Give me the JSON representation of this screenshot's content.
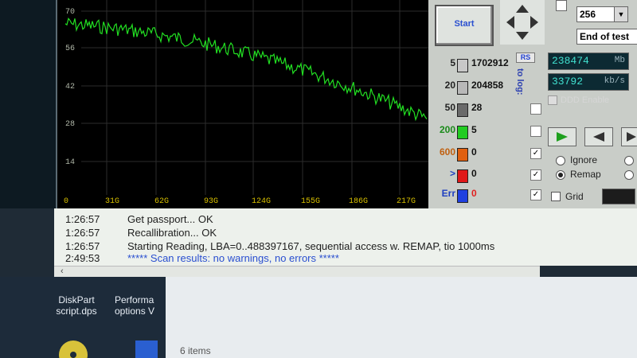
{
  "graph": {
    "y_ticks": [
      "70",
      "56",
      "42",
      "28",
      "14"
    ],
    "x_ticks": [
      "0",
      "31G",
      "62G",
      "93G",
      "124G",
      "155G",
      "186G",
      "217G"
    ],
    "line_color": "#22e022"
  },
  "controls": {
    "start_label": "Start",
    "block_size": "256",
    "end_action": "End of test"
  },
  "histogram": {
    "rs_label": "RS",
    "to_log_label": "to log:",
    "rows": [
      {
        "label": "5",
        "count": "1702912",
        "color": "#c8c8c8",
        "checked": ""
      },
      {
        "label": "20",
        "count": "204858",
        "color": "#b8b8b8",
        "checked": ""
      },
      {
        "label": "50",
        "count": "28",
        "color": "#6a6a6a",
        "checked": ""
      },
      {
        "label": "200",
        "count": "5",
        "color": "#22cc22",
        "checked": ""
      },
      {
        "label": "600",
        "count": "0",
        "color": "#e06010",
        "checked": "✓"
      },
      {
        "label": ">",
        "count": "0",
        "color": "#e01818",
        "checked": "✓"
      },
      {
        "label": "Err",
        "count": "0",
        "color": "#2040e0",
        "checked": "✓"
      }
    ]
  },
  "stats": {
    "mb_value": "238474",
    "mb_unit": "Mb",
    "speed_value": "33792",
    "speed_unit": "kb/s",
    "ddd_label": "DDD Enable"
  },
  "options": {
    "ignore_label": "Ignore",
    "remap_label": "Remap",
    "grid_label": "Grid"
  },
  "log": [
    {
      "time": "1:26:57",
      "text": "Get passport... OK"
    },
    {
      "time": "1:26:57",
      "text": "Recallibration... OK"
    },
    {
      "time": "1:26:57",
      "text": "Starting Reading, LBA=0..488397167, sequential access w. REMAP, tio 1000ms"
    },
    {
      "time": "2:49:53",
      "text": "***** Scan results: no warnings, no errors *****"
    }
  ],
  "desktop": {
    "icon1_label": "DiskPart script.dps",
    "icon2_label": "Performa options V",
    "items_count": "6 items"
  }
}
